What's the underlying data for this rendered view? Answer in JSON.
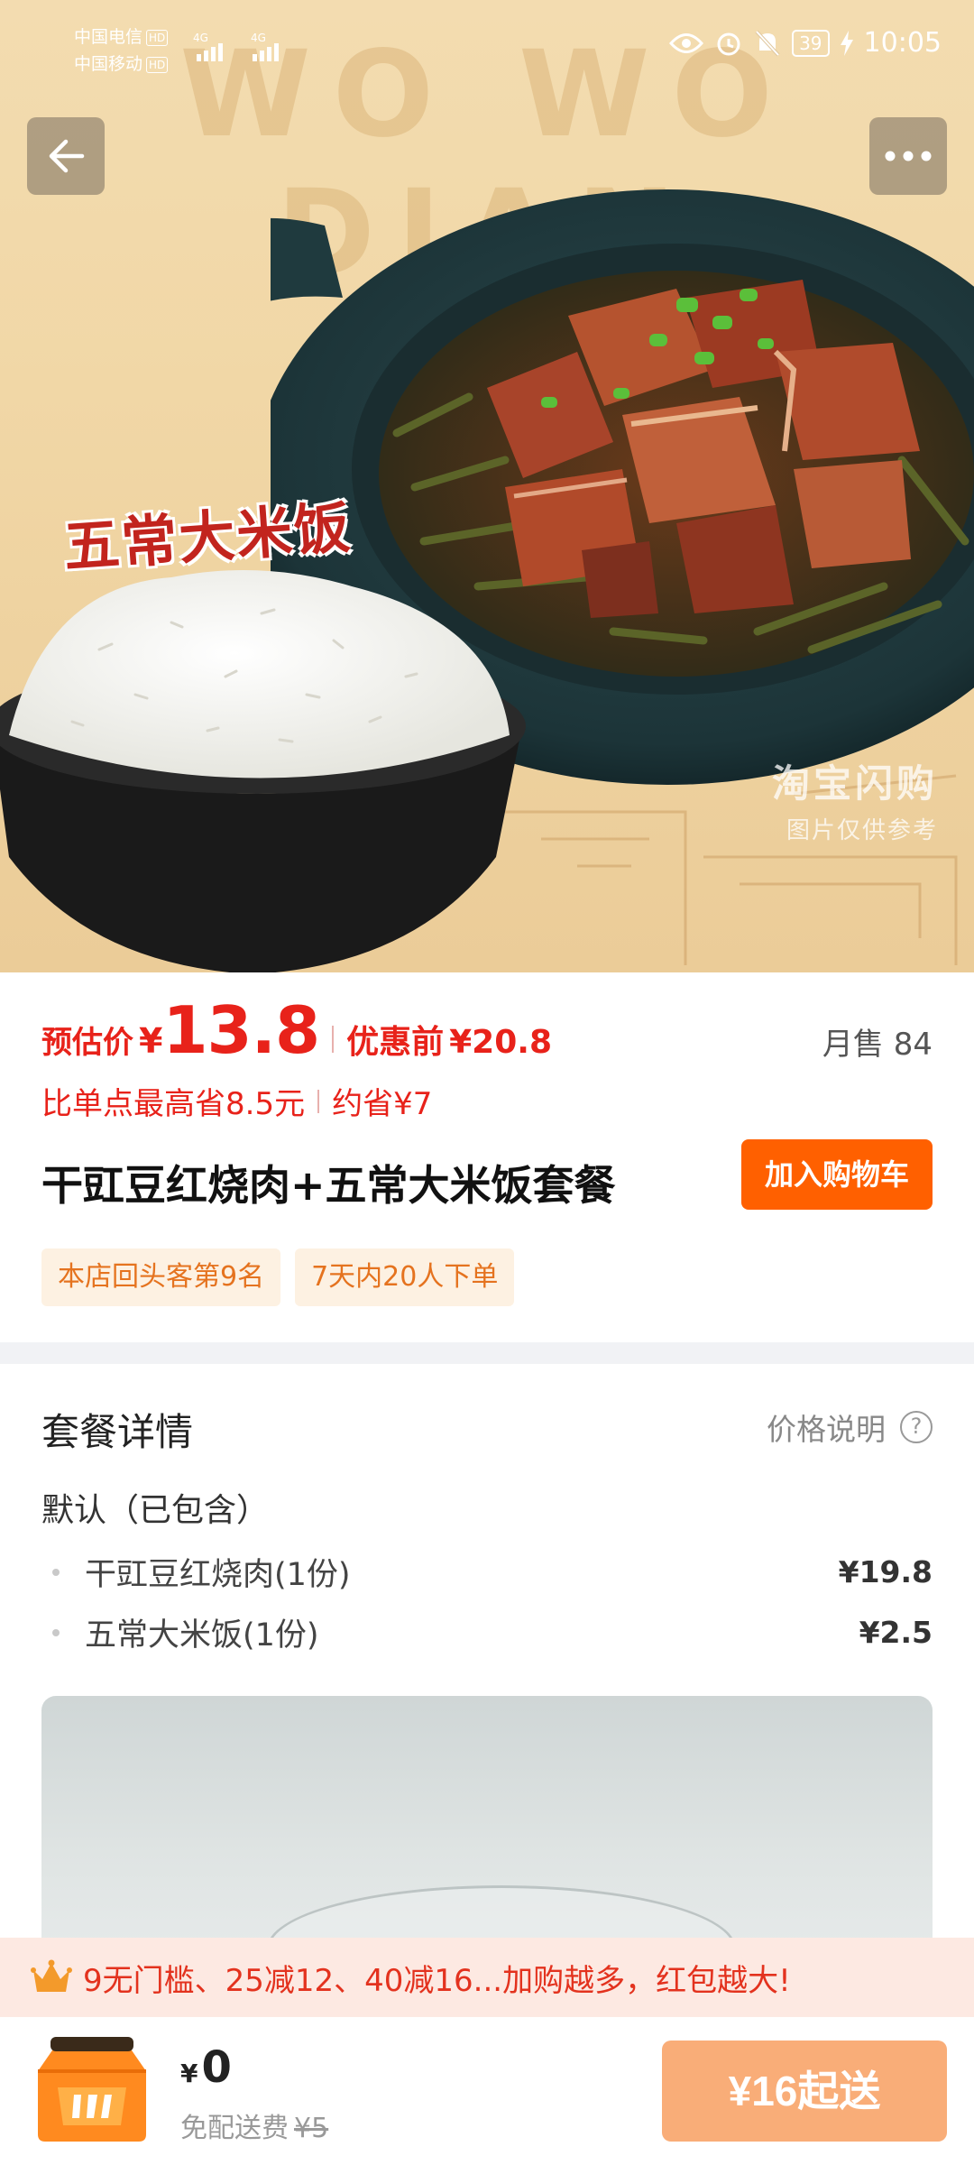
{
  "status_bar": {
    "carrier1": "中国电信",
    "carrier2": "中国移动",
    "hd_badge": "HD",
    "network": "4G",
    "battery": "39",
    "time": "10:05"
  },
  "hero": {
    "brand_text": "WO WO DIAN",
    "bowl_label": "五常大米饭",
    "watermark_line1": "淘宝闪购",
    "watermark_line2": "图片仅供参考"
  },
  "product": {
    "price_label": "预估价",
    "currency": "¥",
    "price": "13.8",
    "original_price_label": "优惠前",
    "original_price": "¥20.8",
    "monthly_sales": "月售 84",
    "save_text_1": "比单点最高省8.5元",
    "save_text_2": "约省¥7",
    "title": "干豇豆红烧肉+五常大米饭套餐",
    "add_to_cart": "加入购物车",
    "tags": [
      "本店回头客第9名",
      "7天内20人下单"
    ]
  },
  "details": {
    "title": "套餐详情",
    "price_note": "价格说明",
    "group_label": "默认（已包含）",
    "items": [
      {
        "name": "干豇豆红烧肉(1份)",
        "price": "¥19.8"
      },
      {
        "name": "五常大米饭(1份)",
        "price": "¥2.5"
      }
    ]
  },
  "promo": {
    "icon": "crown-icon",
    "text": "9无门槛、25减12、40减16...加购越多，红包越大!"
  },
  "cart_bar": {
    "currency": "¥",
    "total": "0",
    "delivery_label": "免配送费",
    "delivery_original": "¥5",
    "checkout_label": "¥16起送"
  },
  "colors": {
    "accent_red": "#e8221a",
    "cart_orange": "#ff6000",
    "checkout_disabled": "#f9ad78",
    "tag_bg": "#fdf1e2",
    "tag_text": "#e5731f"
  }
}
